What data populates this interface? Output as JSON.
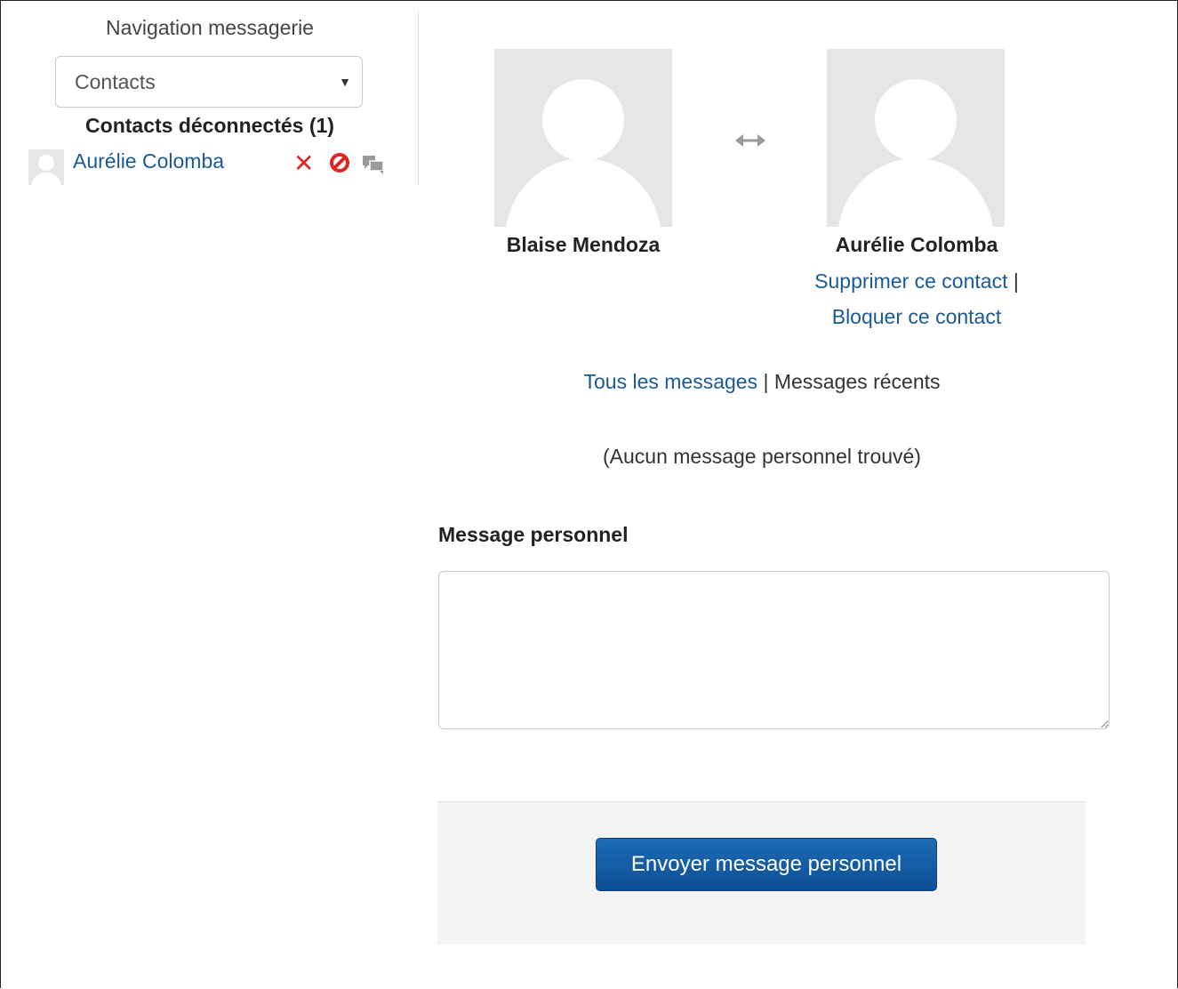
{
  "navigation": {
    "title": "Navigation messagerie",
    "select_value": "Contacts",
    "contacts_heading": "Contacts déconnectés (1)",
    "contacts": [
      {
        "name": "Aurélie Colomba",
        "icons": [
          "remove-contact-icon",
          "block-contact-icon",
          "message-history-icon"
        ]
      }
    ]
  },
  "conversation": {
    "user_left": "Blaise Mendoza",
    "user_right": "Aurélie Colomba",
    "swap_icon": "bidirectional-arrow-icon",
    "remove_contact_link": "Supprimer ce contact",
    "separator": "|",
    "block_contact_link": "Bloquer ce contact",
    "all_messages_link": "Tous les messages",
    "recent_messages": "Messages récents",
    "no_messages": "(Aucun message personnel trouvé)"
  },
  "form": {
    "label": "Message personnel",
    "message_value": "",
    "send_button": "Envoyer message personnel"
  },
  "colors": {
    "link": "#1a5a96",
    "remove_icon": "#e02525",
    "button": "#0e5aa4"
  }
}
